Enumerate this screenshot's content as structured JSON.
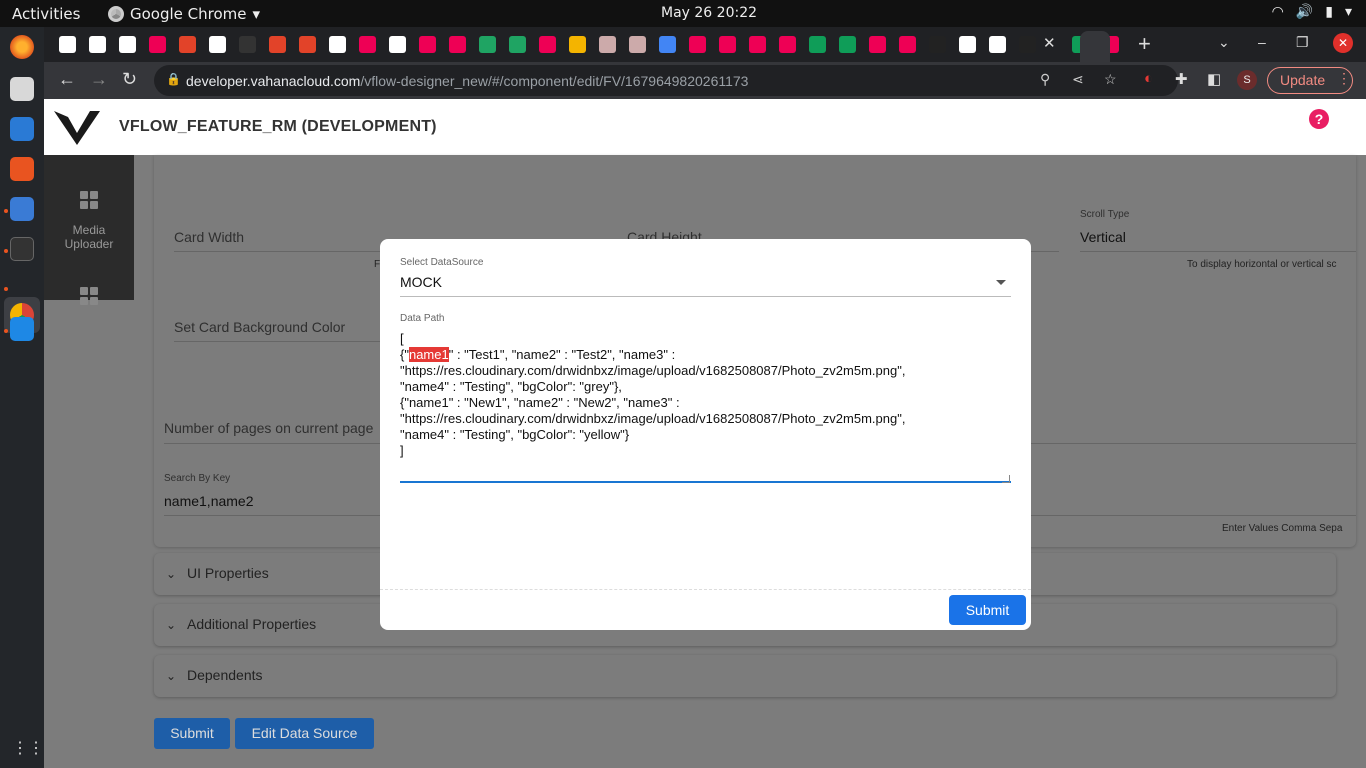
{
  "system_bar": {
    "activities": "Activities",
    "app_name": "Google Chrome",
    "clock": "May 26  20:22"
  },
  "browser": {
    "url_host": "developer.vahanacloud.com",
    "url_path": "/vflow-designer_new/#/component/edit/FV/1679649820261173",
    "profile_initial": "S",
    "update_label": "Update"
  },
  "app": {
    "title": "VFLOW_FEATURE_RM (DEVELOPMENT)"
  },
  "sidebar": {
    "media_uploader": "Media\nUploader"
  },
  "form": {
    "card_width_label": "Card Width",
    "card_height_label": "Card Height",
    "scroll_type_label": "Scroll Type",
    "scroll_type_value": "Vertical",
    "scroll_type_hint": "To display horizontal or vertical sc",
    "bg_color_label": "Set Card Background Color",
    "pages_label": "Number of pages on current page",
    "search_key_label": "Search By Key",
    "search_key_value": "name1,name2",
    "search_key_hint": "Enter Values Comma Sepa",
    "card_width_hint_fragment": "F"
  },
  "accordions": {
    "ui_properties": "UI Properties",
    "additional_properties": "Additional Properties",
    "dependents": "Dependents"
  },
  "page_buttons": {
    "submit": "Submit",
    "edit_data_source": "Edit Data Source"
  },
  "modal": {
    "datasource_label": "Select DataSource",
    "datasource_value": "MOCK",
    "data_path_label": "Data Path",
    "data_path_text": {
      "l1": "[",
      "l2_pre": "{\"",
      "l2_hl": "name1",
      "l2_post": "\" : \"Test1\", \"name2\" : \"Test2\", \"name3\" :",
      "l3": "\"https://res.cloudinary.com/drwidnbxz/image/upload/v1682508087/Photo_zv2m5m.png\",",
      "l4": "\"name4\" : \"Testing\", \"bgColor\": \"grey\"},",
      "l5": "{\"name1\" : \"New1\", \"name2\" : \"New2\", \"name3\" :",
      "l6": "\"https://res.cloudinary.com/drwidnbxz/image/upload/v1682508087/Photo_zv2m5m.png\",",
      "l7": "\"name4\" : \"Testing\", \"bgColor\": \"yellow\"}",
      "l8": "]"
    },
    "submit_label": "Submit"
  }
}
